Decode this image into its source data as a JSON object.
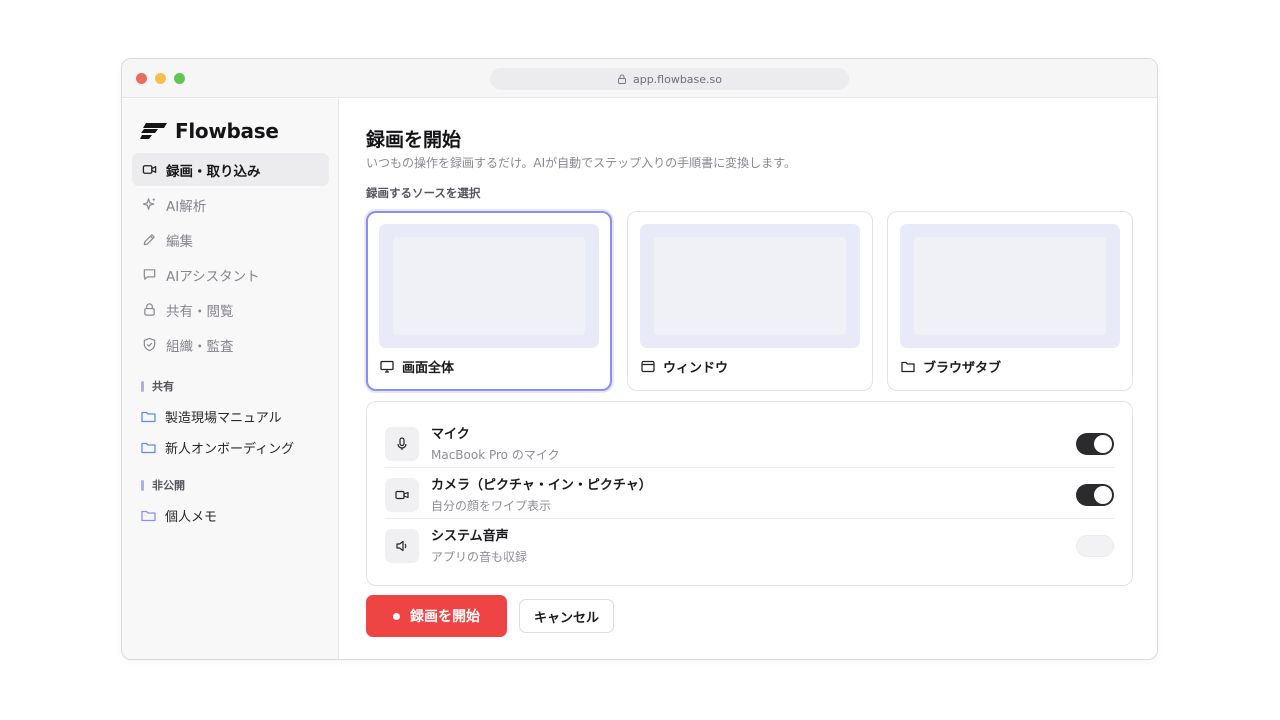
{
  "browser": {
    "url": "app.flowbase.so"
  },
  "brand": {
    "name": "Flowbase"
  },
  "nav": [
    {
      "label": "録画・取り込み",
      "icon": "video-icon",
      "active": true
    },
    {
      "label": "AI解析",
      "icon": "sparkle-icon",
      "active": false
    },
    {
      "label": "編集",
      "icon": "pencil-icon",
      "active": false
    },
    {
      "label": "AIアシスタント",
      "icon": "chat-icon",
      "active": false
    },
    {
      "label": "共有・閲覧",
      "icon": "lock-icon",
      "active": false
    },
    {
      "label": "組織・監査",
      "icon": "shield-icon",
      "active": false
    }
  ],
  "sections": {
    "shared": {
      "label": "共有",
      "folders": [
        "製造現場マニュアル",
        "新人オンボーディング"
      ]
    },
    "private": {
      "label": "非公開",
      "folders": [
        "個人メモ"
      ]
    }
  },
  "page": {
    "title": "録画を開始",
    "subtitle": "いつもの操作を録画するだけ。AIが自動でステップ入りの手順書に変換します。",
    "source_label": "録画するソースを選択"
  },
  "sources": [
    {
      "label": "画面全体",
      "icon": "monitor-icon",
      "selected": true
    },
    {
      "label": "ウィンドウ",
      "icon": "window-icon",
      "selected": false
    },
    {
      "label": "ブラウザタブ",
      "icon": "folder-tab-icon",
      "selected": false
    }
  ],
  "options": [
    {
      "title": "マイク",
      "desc": "MacBook Pro のマイク",
      "icon": "microphone-icon",
      "enabled": true
    },
    {
      "title": "カメラ（ピクチャ・イン・ピクチャ）",
      "desc": "自分の顔をワイプ表示",
      "icon": "camera-icon",
      "enabled": true
    },
    {
      "title": "システム音声",
      "desc": "アプリの音も収録",
      "icon": "speaker-icon",
      "enabled": false
    }
  ],
  "actions": {
    "start": "録画を開始",
    "cancel": "キャンセル"
  },
  "colors": {
    "accent": "#ef4444",
    "selection": "#8a90f0",
    "toggle_on": "#2b2b2e"
  }
}
